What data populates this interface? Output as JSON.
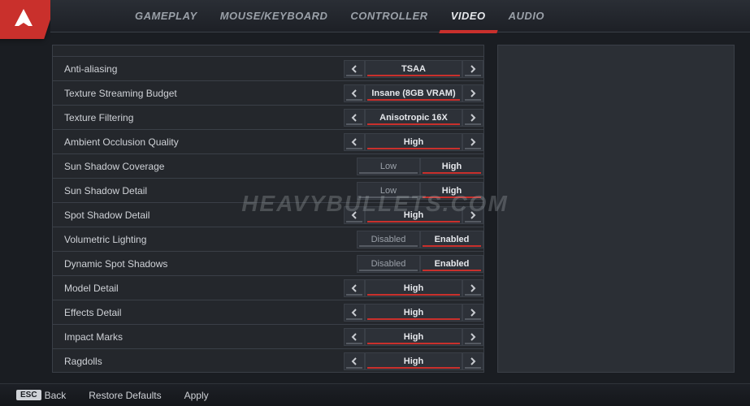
{
  "tabs": {
    "gameplay": "GAMEPLAY",
    "mousekb": "MOUSE/KEYBOARD",
    "controller": "CONTROLLER",
    "video": "VIDEO",
    "audio": "AUDIO"
  },
  "settings": {
    "anti_aliasing": {
      "label": "Anti-aliasing",
      "value": "TSAA"
    },
    "tex_stream": {
      "label": "Texture Streaming Budget",
      "value": "Insane (8GB VRAM)"
    },
    "tex_filter": {
      "label": "Texture Filtering",
      "value": "Anisotropic 16X"
    },
    "ao_quality": {
      "label": "Ambient Occlusion Quality",
      "value": "High"
    },
    "sun_cov": {
      "label": "Sun Shadow Coverage",
      "opt_a": "Low",
      "opt_b": "High"
    },
    "sun_detail": {
      "label": "Sun Shadow Detail",
      "opt_a": "Low",
      "opt_b": "High"
    },
    "spot_detail": {
      "label": "Spot Shadow Detail",
      "value": "High"
    },
    "vol_light": {
      "label": "Volumetric Lighting",
      "opt_a": "Disabled",
      "opt_b": "Enabled"
    },
    "dyn_spot": {
      "label": "Dynamic Spot Shadows",
      "opt_a": "Disabled",
      "opt_b": "Enabled"
    },
    "model_detail": {
      "label": "Model Detail",
      "value": "High"
    },
    "effects_detail": {
      "label": "Effects Detail",
      "value": "High"
    },
    "impact_marks": {
      "label": "Impact Marks",
      "value": "High"
    },
    "ragdolls": {
      "label": "Ragdolls",
      "value": "High"
    }
  },
  "footer": {
    "esc": "ESC",
    "back": "Back",
    "restore": "Restore Defaults",
    "apply": "Apply"
  },
  "watermark": "HEAVYBULLETS.COM"
}
